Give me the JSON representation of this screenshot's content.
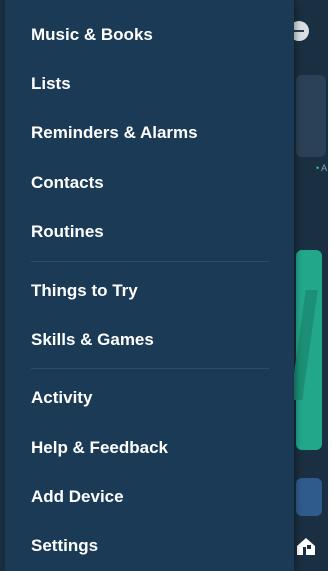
{
  "menu": {
    "items": [
      {
        "label": "Music & Books"
      },
      {
        "label": "Lists"
      },
      {
        "label": "Reminders & Alarms"
      },
      {
        "label": "Contacts"
      },
      {
        "label": "Routines"
      },
      {
        "label": "Things to Try"
      },
      {
        "label": "Skills & Games"
      },
      {
        "label": "Activity"
      },
      {
        "label": "Help & Feedback"
      },
      {
        "label": "Add Device"
      },
      {
        "label": "Settings"
      }
    ]
  },
  "background": {
    "hint_text": "A",
    "icons": [
      "collapse-icon",
      "home-icon"
    ]
  },
  "colors": {
    "drawer_bg": "#1a3a56",
    "divider": "#2f4c68",
    "text": "#ffffff",
    "teal_card": "#23a78a",
    "blue_card": "#2f5b8c"
  }
}
